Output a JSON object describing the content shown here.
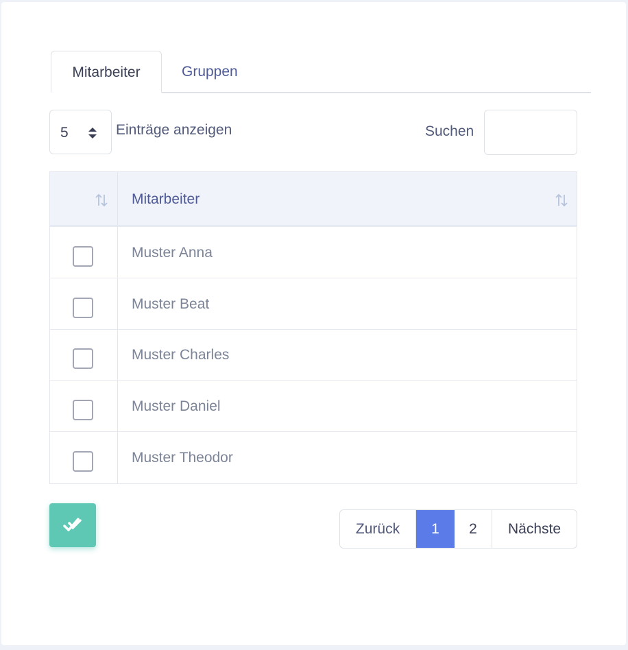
{
  "tabs": [
    {
      "label": "Mitarbeiter",
      "active": true
    },
    {
      "label": "Gruppen",
      "active": false
    }
  ],
  "length_menu": {
    "value": "5",
    "label": "Einträge anzeigen"
  },
  "search": {
    "label": "Suchen",
    "value": ""
  },
  "table": {
    "header": "Mitarbeiter",
    "rows": [
      {
        "name": "Muster Anna"
      },
      {
        "name": "Muster Beat"
      },
      {
        "name": "Muster Charles"
      },
      {
        "name": "Muster Daniel"
      },
      {
        "name": "Muster Theodor"
      }
    ]
  },
  "pagination": {
    "prev": "Zurück",
    "pages": [
      "1",
      "2"
    ],
    "current": "1",
    "next": "Nächste"
  },
  "colors": {
    "accent": "#5b7ce8",
    "submit": "#5fc8b5"
  },
  "icons": {
    "submit": "double-check-icon",
    "sort": "sort-icon",
    "select": "select-arrows-icon"
  }
}
